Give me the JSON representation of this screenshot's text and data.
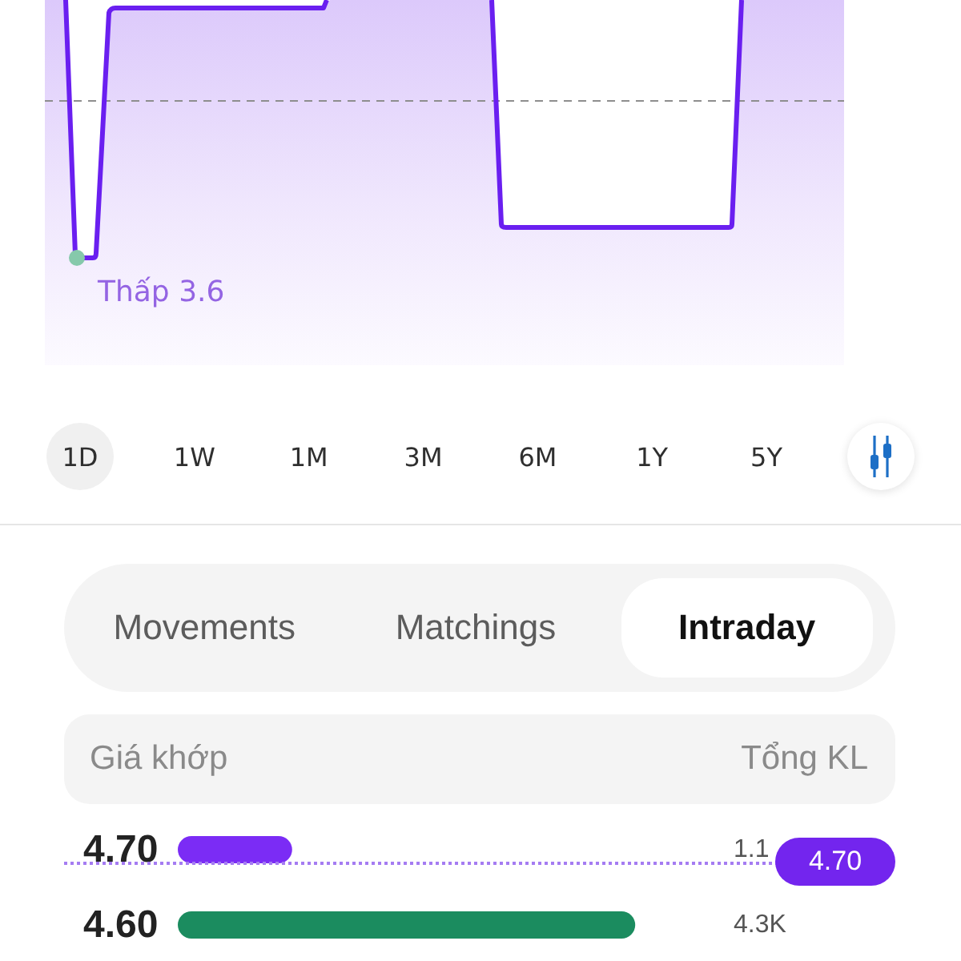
{
  "chart": {
    "low_label": "Thấp 3.6"
  },
  "periods": [
    {
      "label": "1D",
      "selected": true
    },
    {
      "label": "1W",
      "selected": false
    },
    {
      "label": "1M",
      "selected": false
    },
    {
      "label": "3M",
      "selected": false
    },
    {
      "label": "6M",
      "selected": false
    },
    {
      "label": "1Y",
      "selected": false
    },
    {
      "label": "5Y",
      "selected": false
    }
  ],
  "tabs": [
    {
      "label": "Movements",
      "selected": false
    },
    {
      "label": "Matchings",
      "selected": false
    },
    {
      "label": "Intraday",
      "selected": true
    }
  ],
  "table": {
    "columns": [
      "Giá khớp",
      "Tổng KL"
    ],
    "rows": [
      {
        "price": "4.70",
        "volume": "1.1",
        "level": 0.21,
        "color": "#7b2cf5",
        "price_tag": "4.70"
      },
      {
        "price": "4.60",
        "volume": "4.3K",
        "level": 0.84,
        "color": "#1b8c5f"
      }
    ]
  }
}
